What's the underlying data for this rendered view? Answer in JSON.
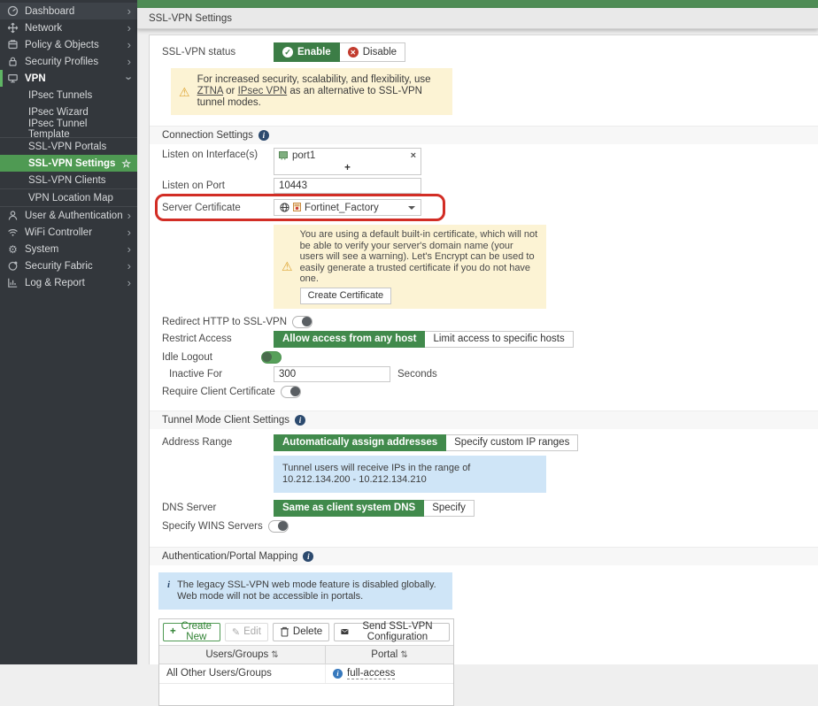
{
  "tabbar": {
    "title": "SSL-VPN Settings"
  },
  "sidebar": {
    "items": [
      {
        "label": "Dashboard",
        "icon": "gauge-icon"
      },
      {
        "label": "Network",
        "icon": "network-arrows-icon"
      },
      {
        "label": "Policy & Objects",
        "icon": "policy-objects-icon"
      },
      {
        "label": "Security Profiles",
        "icon": "lock-icon"
      },
      {
        "label": "VPN",
        "icon": "monitor-icon"
      },
      {
        "label": "User & Authentication",
        "icon": "user-icon"
      },
      {
        "label": "WiFi Controller",
        "icon": "wifi-icon"
      },
      {
        "label": "System",
        "icon": "gear-icon"
      },
      {
        "label": "Security Fabric",
        "icon": "security-fabric-icon"
      },
      {
        "label": "Log & Report",
        "icon": "bar-chart-icon"
      }
    ],
    "vpn_submenu": [
      {
        "label": "IPsec Tunnels"
      },
      {
        "label": "IPsec Wizard"
      },
      {
        "label": "IPsec Tunnel Template"
      },
      {
        "label": "SSL-VPN Portals"
      },
      {
        "label": "SSL-VPN Settings",
        "active": true,
        "favorite": true
      },
      {
        "label": "SSL-VPN Clients"
      },
      {
        "label": "VPN Location Map"
      }
    ]
  },
  "status": {
    "label": "SSL-VPN status",
    "enable_label": "Enable",
    "disable_label": "Disable",
    "value": "Enable"
  },
  "ztna_notice": {
    "text_before": "For increased security, scalability, and flexibility, use ",
    "link_ztna": "ZTNA",
    "text_or": " or ",
    "link_ipsec": "IPsec VPN",
    "text_after": " as an alternative to SSL-VPN tunnel modes."
  },
  "connection": {
    "heading": "Connection Settings",
    "listen_interfaces": {
      "label": "Listen on Interface(s)",
      "entry": "port1",
      "add_label": "+"
    },
    "listen_port": {
      "label": "Listen on Port",
      "value": "10443"
    },
    "server_certificate": {
      "label": "Server Certificate",
      "value": "Fortinet_Factory"
    },
    "certificate_notice": {
      "text": "You are using a default built-in certificate, which will not be able to verify your server's domain name (your users will see a warning). Let's Encrypt can be used to easily generate a trusted certificate if you do not have one.",
      "button_label": "Create Certificate"
    },
    "redirect_http": {
      "label": "Redirect HTTP to SSL-VPN",
      "enabled": false
    },
    "restrict_access": {
      "label": "Restrict Access",
      "options": [
        "Allow access from any host",
        "Limit access to specific hosts"
      ],
      "selected": "Allow access from any host"
    },
    "idle_logout": {
      "label": "Idle Logout",
      "enabled": true
    },
    "inactive_for": {
      "label": "Inactive For",
      "value": "300",
      "unit": "Seconds"
    },
    "require_client_certificate": {
      "label": "Require Client Certificate",
      "enabled": false
    }
  },
  "tunnel_mode": {
    "heading": "Tunnel Mode Client Settings",
    "address_range": {
      "label": "Address Range",
      "options": [
        "Automatically assign addresses",
        "Specify custom IP ranges"
      ],
      "selected": "Automatically assign addresses"
    },
    "ip_range_notice": "Tunnel users will receive IPs in the range of 10.212.134.200 - 10.212.134.210",
    "dns_server": {
      "label": "DNS Server",
      "options": [
        "Same as client system DNS",
        "Specify"
      ],
      "selected": "Same as client system DNS"
    },
    "specify_wins": {
      "label": "Specify WINS Servers",
      "enabled": false
    }
  },
  "portal_mapping": {
    "heading": "Authentication/Portal Mapping",
    "notice": "The legacy SSL-VPN web mode feature is disabled globally. Web mode will not be accessible in portals.",
    "toolbar": {
      "create_label": "Create New",
      "edit_label": "Edit",
      "delete_label": "Delete",
      "send_label": "Send SSL-VPN Configuration"
    },
    "table": {
      "columns": [
        "Users/Groups",
        "Portal"
      ],
      "rows": [
        {
          "users_groups": "All Other Users/Groups",
          "portal": "full-access"
        }
      ]
    }
  }
}
